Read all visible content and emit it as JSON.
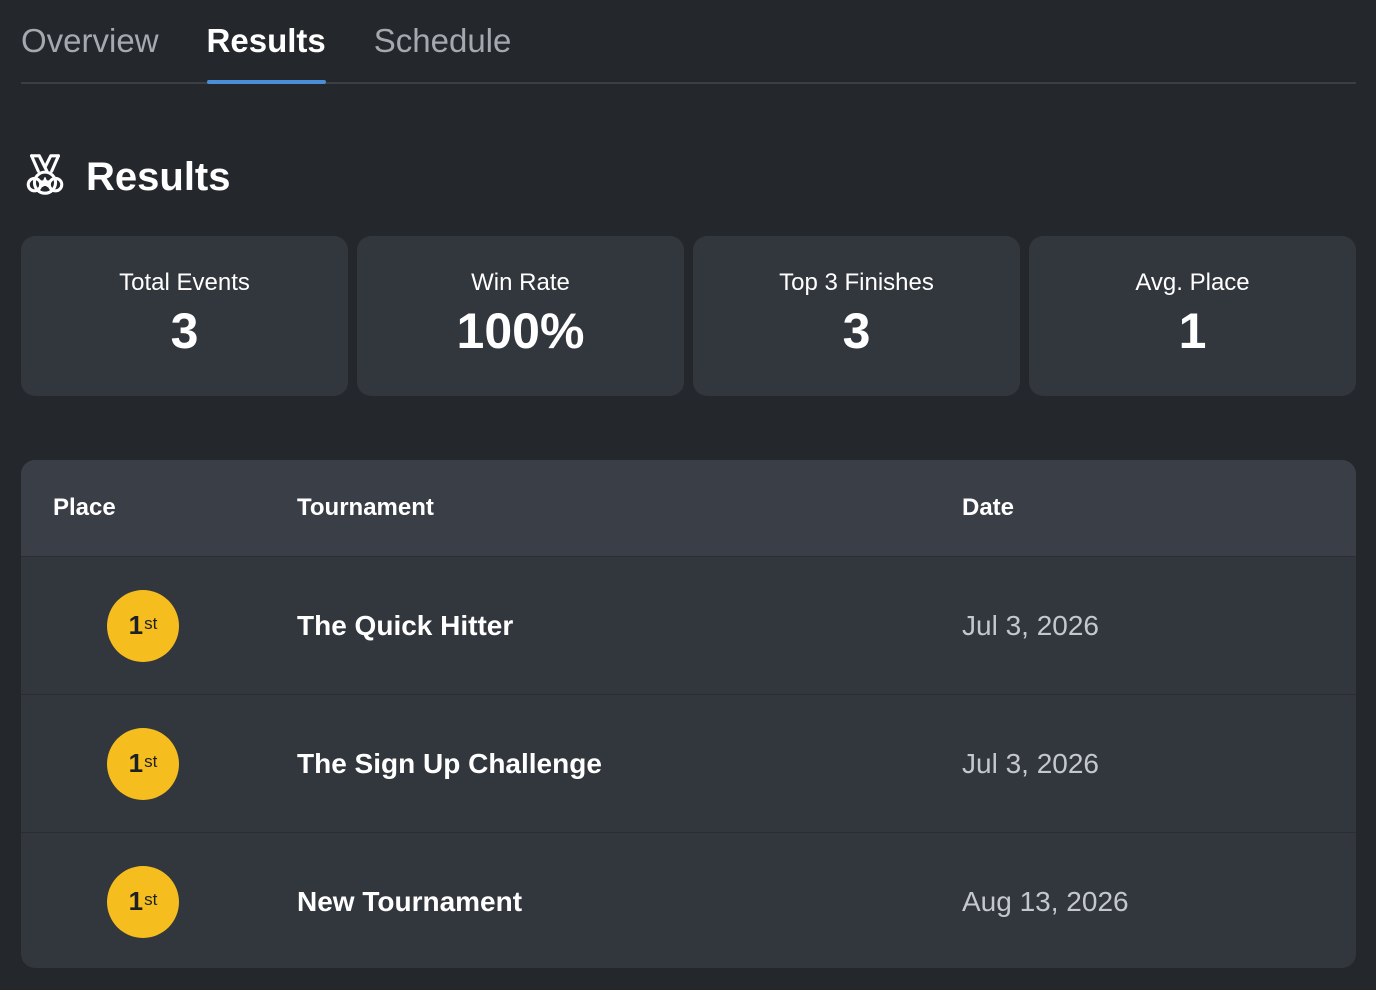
{
  "tabs": [
    {
      "label": "Overview",
      "active": false
    },
    {
      "label": "Results",
      "active": true
    },
    {
      "label": "Schedule",
      "active": false
    }
  ],
  "section": {
    "title": "Results",
    "icon": "medal-icon"
  },
  "stats": [
    {
      "label": "Total Events",
      "value": "3"
    },
    {
      "label": "Win Rate",
      "value": "100%"
    },
    {
      "label": "Top 3 Finishes",
      "value": "3"
    },
    {
      "label": "Avg. Place",
      "value": "1"
    }
  ],
  "table": {
    "headers": {
      "place": "Place",
      "tournament": "Tournament",
      "date": "Date"
    },
    "rows": [
      {
        "place_num": "1",
        "place_suffix": "st",
        "tournament": "The Quick Hitter",
        "date": "Jul 3, 2026"
      },
      {
        "place_num": "1",
        "place_suffix": "st",
        "tournament": "The Sign Up Challenge",
        "date": "Jul 3, 2026"
      },
      {
        "place_num": "1",
        "place_suffix": "st",
        "tournament": "New Tournament",
        "date": "Aug 13, 2026"
      }
    ]
  },
  "colors": {
    "background": "#24282d",
    "card": "#32363d",
    "accent": "#4a8fd6",
    "gold_badge": "#f5be1e"
  }
}
